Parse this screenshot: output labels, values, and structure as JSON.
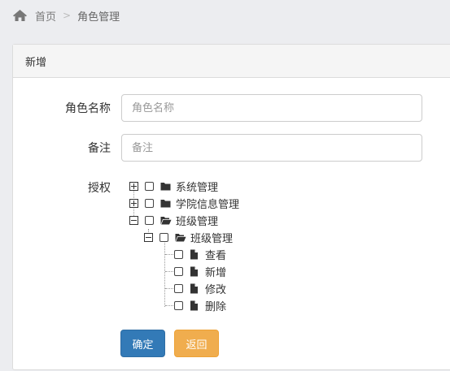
{
  "breadcrumb": {
    "home_icon": "home-icon",
    "home": "首页",
    "separator": ">",
    "current": "角色管理"
  },
  "panel": {
    "title": "新增"
  },
  "form": {
    "role_name": {
      "label": "角色名称",
      "placeholder": "角色名称",
      "value": ""
    },
    "remark": {
      "label": "备注",
      "placeholder": "备注",
      "value": ""
    },
    "auth_label": "授权"
  },
  "tree": {
    "nodes": [
      {
        "label": "系统管理",
        "icon": "folder-closed-icon",
        "toggle": "plus",
        "checked": false
      },
      {
        "label": "学院信息管理",
        "icon": "folder-closed-icon",
        "toggle": "plus",
        "checked": false
      },
      {
        "label": "班级管理",
        "icon": "folder-open-icon",
        "toggle": "minus",
        "checked": false
      },
      {
        "label": "班级管理",
        "icon": "folder-open-icon",
        "toggle": "minus",
        "checked": false
      },
      {
        "label": "查看",
        "icon": "file-icon",
        "checked": false
      },
      {
        "label": "新增",
        "icon": "file-icon",
        "checked": false
      },
      {
        "label": "修改",
        "icon": "file-icon",
        "checked": false
      },
      {
        "label": "删除",
        "icon": "file-icon",
        "checked": false
      }
    ]
  },
  "buttons": {
    "confirm": "确定",
    "back": "返回"
  },
  "colors": {
    "primary": "#337ab7",
    "warning": "#f0ad4e",
    "page_bg": "#ecedf0"
  }
}
